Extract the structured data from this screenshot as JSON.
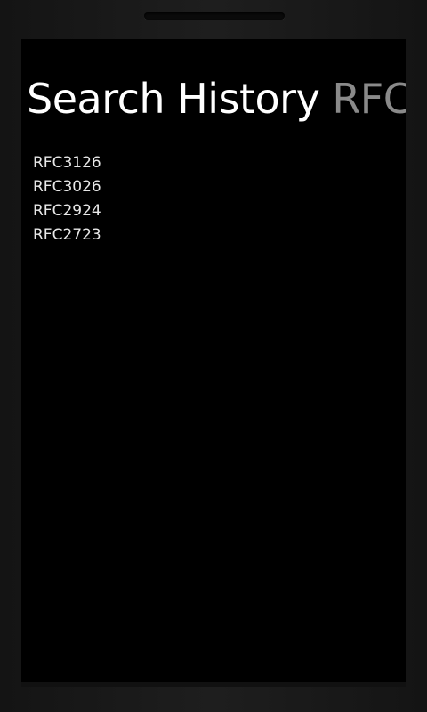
{
  "pivot": {
    "active_title": "Search History",
    "next_title": "RFC"
  },
  "history": {
    "items": [
      {
        "label": "RFC3126"
      },
      {
        "label": "RFC3026"
      },
      {
        "label": "RFC2924"
      },
      {
        "label": "RFC2723"
      }
    ]
  }
}
